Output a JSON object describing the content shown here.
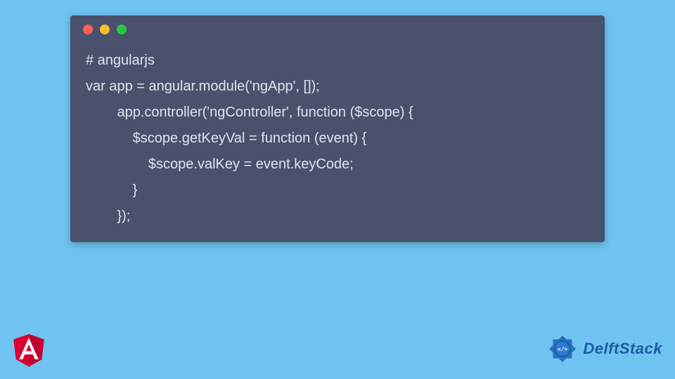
{
  "code": {
    "lines": [
      "# angularjs",
      "var app = angular.module('ngApp', []);",
      "        app.controller('ngController', function ($scope) {",
      "            $scope.getKeyVal = function (event) {",
      "                $scope.valKey = event.keyCode;",
      "            }",
      "        });"
    ]
  },
  "logos": {
    "angular_letter": "A",
    "delft_text": "DelftStack"
  },
  "colors": {
    "background": "#6fc3f0",
    "window": "#4a516d",
    "code_text": "#e0e3ec",
    "angular_red": "#dd0031",
    "angular_dark": "#c3002f",
    "delft_blue": "#1e5ba6"
  }
}
